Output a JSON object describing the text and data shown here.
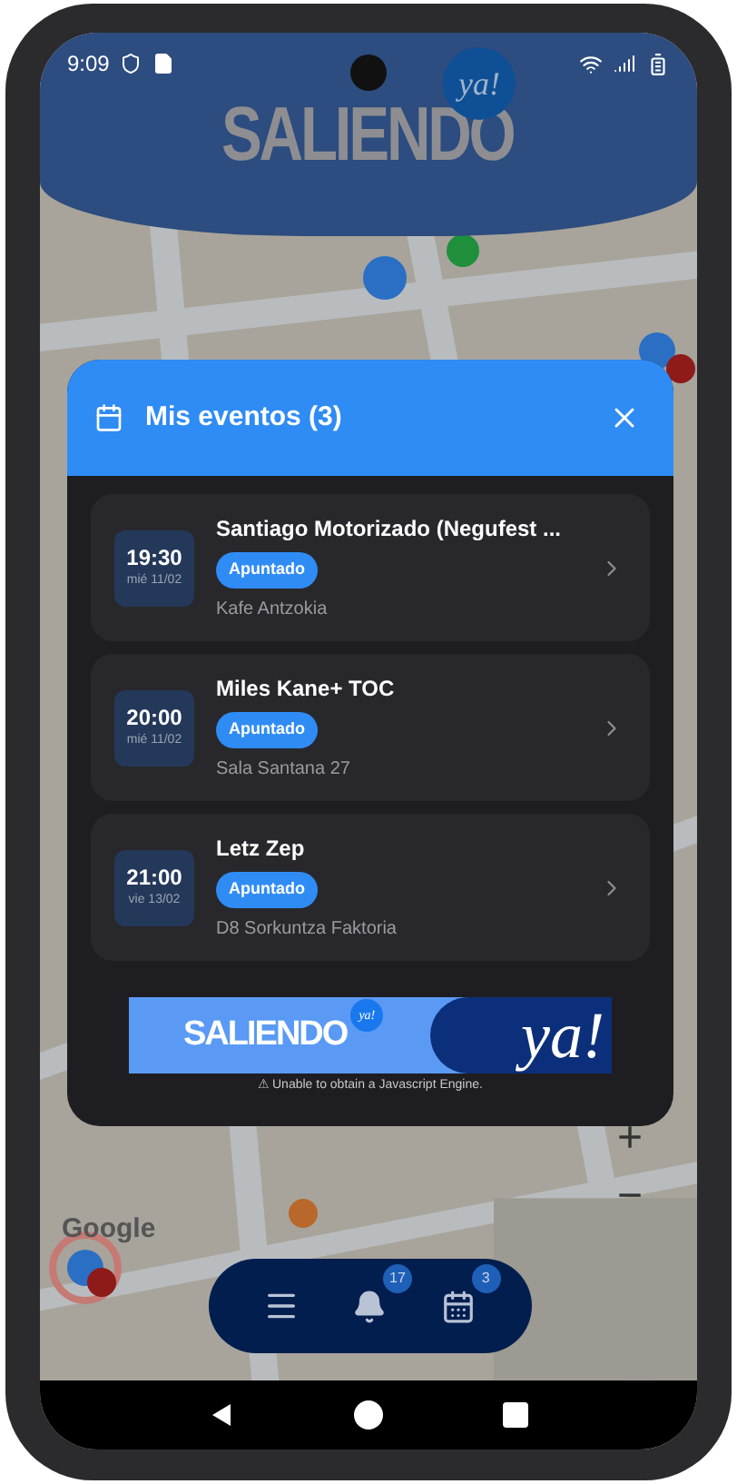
{
  "status_bar": {
    "time": "9:09"
  },
  "header": {
    "logo": "SALIENDO",
    "badge": "ya!"
  },
  "map": {
    "kind": "picture",
    "attribution": "Google",
    "zoom_in": "+",
    "zoom_out": "−"
  },
  "modal": {
    "title": "Mis eventos (3)"
  },
  "events": [
    {
      "time": "19:30",
      "date": "mié 11/02",
      "title": "Santiago Motorizado (Negufest ...",
      "status": "Apuntado",
      "venue": "Kafe Antzokia"
    },
    {
      "time": "20:00",
      "date": "mié 11/02",
      "title": "Miles Kane+ TOC",
      "status": "Apuntado",
      "venue": "Sala Santana 27"
    },
    {
      "time": "21:00",
      "date": "vie 13/02",
      "title": "Letz Zep",
      "status": "Apuntado",
      "venue": "D8 Sorkuntza Faktoria"
    }
  ],
  "banner": {
    "logo": "SALIENDO",
    "badge": "ya!",
    "slogan": "ya!",
    "caption": "⚠ Unable to obtain a Javascript Engine."
  },
  "bottom_nav": [
    {
      "kind": "menu"
    },
    {
      "kind": "notifications",
      "count": "17"
    },
    {
      "kind": "events",
      "count": "3"
    }
  ]
}
